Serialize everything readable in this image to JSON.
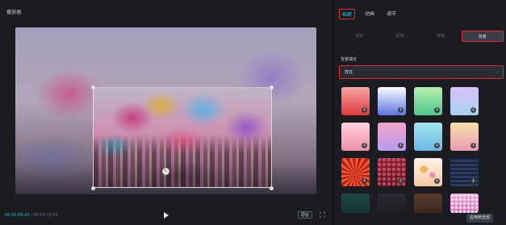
{
  "player": {
    "title": "播放器",
    "timecode_current": "00:00:05:20",
    "timecode_total": " / 00:00:15:05",
    "ratio_label": "原始",
    "play_icon": "play-icon",
    "fullscreen_icon": "fullscreen-icon",
    "rotate_icon": "rotate-icon"
  },
  "inspector": {
    "tabs": [
      {
        "label": "画面",
        "active": true
      },
      {
        "label": "动画",
        "active": false
      },
      {
        "label": "调节",
        "active": false
      }
    ],
    "subtabs": [
      {
        "label": "基础",
        "active": false
      },
      {
        "label": "抠像",
        "active": false
      },
      {
        "label": "蒙版",
        "active": false
      },
      {
        "label": "背景",
        "active": true
      }
    ],
    "section_label": "背景填充",
    "dropdown_value": "样式",
    "swatches": [
      {
        "colors": [
          "#f6a7a7",
          "#e0383a"
        ],
        "downloadable": true
      },
      {
        "colors": [
          "#ffffff",
          "#5a74e0"
        ],
        "downloadable": true
      },
      {
        "colors": [
          "#b9f0b0",
          "#4fc58e"
        ],
        "downloadable": true
      },
      {
        "colors": [
          "#d7c2f5",
          "#a9d1f3"
        ],
        "downloadable": true
      },
      {
        "colors": [
          "#ffd2dc",
          "#f08da6"
        ],
        "downloadable": true
      },
      {
        "colors": [
          "#f1a3c9",
          "#b99cf1"
        ],
        "downloadable": true
      },
      {
        "colors": [
          "#a4e4ef",
          "#6ab8e4"
        ],
        "downloadable": true
      },
      {
        "colors": [
          "#f7e0a8",
          "#e99bb4"
        ],
        "downloadable": true
      },
      {
        "colors": [
          "#e6452a",
          "#b31f18"
        ],
        "downloadable": true
      },
      {
        "colors": [
          "#8d2233",
          "#5a1420"
        ],
        "downloadable": true
      },
      {
        "colors": [
          "#fff2e6",
          "#f5c9a0"
        ],
        "downloadable": true
      },
      {
        "colors": [
          "#23324f",
          "#16203a"
        ],
        "downloadable": true
      },
      {
        "colors": [
          "#1e4a44",
          "#143531"
        ],
        "downloadable": false
      },
      {
        "colors": [
          "#2a2c33",
          "#1c1d22"
        ],
        "downloadable": false
      },
      {
        "colors": [
          "#5a3a2e",
          "#3d2720"
        ],
        "downloadable": false
      },
      {
        "colors": [
          "#f3a6d8",
          "#d475b8"
        ],
        "downloadable": false
      }
    ],
    "download_icon": "download-icon",
    "chevron_icon": "chevron-down-icon"
  },
  "footer": {
    "apply_all_label": "应用到全部"
  }
}
